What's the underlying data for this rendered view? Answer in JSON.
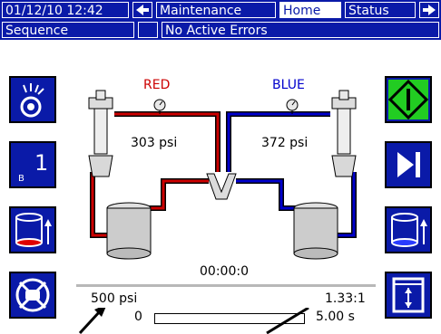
{
  "header": {
    "datetime": "01/12/10 12:42",
    "tabs": [
      "Maintenance",
      "Home",
      "Status"
    ],
    "selected_tab": "Home"
  },
  "status_row": {
    "mode": "Sequence",
    "errors": "No Active Errors"
  },
  "diagram": {
    "red_label": "RED",
    "blue_label": "BLUE",
    "red_pressure": "303 psi",
    "blue_pressure": "372 psi",
    "timer": "00:00:0",
    "pressure_setpoint": "500 psi",
    "ratio": "1.33:1",
    "range_min": "0",
    "range_max": "5.00 s",
    "progress": 0
  },
  "left_buttons": [
    {
      "icon": "spray-gun-icon"
    },
    {
      "icon": "sequence-1-icon",
      "label": "1",
      "sublabel": "B"
    },
    {
      "icon": "red-tank-fill-icon"
    },
    {
      "icon": "flush-icon"
    }
  ],
  "right_buttons": [
    {
      "icon": "start-diamond-icon"
    },
    {
      "icon": "skip-forward-icon"
    },
    {
      "icon": "blue-tank-fill-icon"
    },
    {
      "icon": "pump-park-icon"
    }
  ],
  "colors": {
    "header_blue": "#0a1aa8",
    "red_line": "#cc0000",
    "blue_line": "#0000cc",
    "start_green": "#22cc22"
  }
}
